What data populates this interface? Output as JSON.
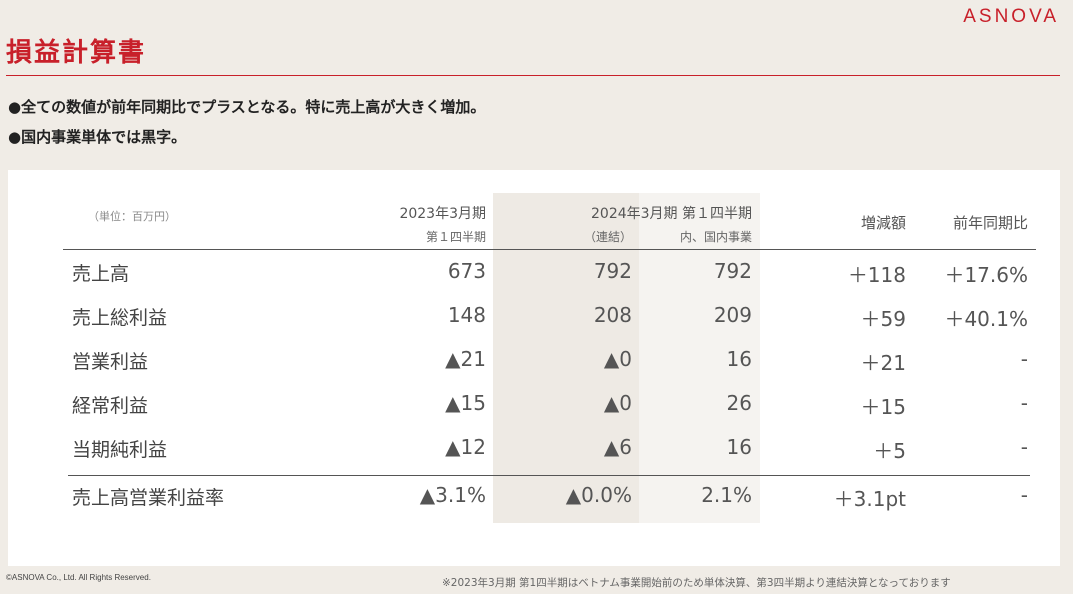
{
  "header": {
    "logo": "ASNOVA",
    "title": "損益計算書"
  },
  "bullets": [
    "●全ての数値が前年同期比でプラスとなる。特に売上高が大きく増加。",
    "●国内事業単体では黒字。"
  ],
  "table": {
    "unit": "（単位：百万円）",
    "col_prev": "2023年3月期",
    "col_prev_sub": "第１四半期",
    "col_curr": "2024年3月期 第１四半期",
    "col_curr_sub_a": "（連結）",
    "col_curr_sub_b": "内、国内事業",
    "col_diff": "増減額",
    "col_ratio": "前年同期比",
    "rows": [
      {
        "label": "売上高",
        "prev": "673",
        "cons": "792",
        "dom": "792",
        "diff": "＋118",
        "ratio": "＋17.6%"
      },
      {
        "label": "売上総利益",
        "prev": "148",
        "cons": "208",
        "dom": "209",
        "diff": "＋59",
        "ratio": "＋40.1%"
      },
      {
        "label": "営業利益",
        "prev": "▲21",
        "cons": "▲0",
        "dom": "16",
        "diff": "＋21",
        "ratio": "-"
      },
      {
        "label": "経常利益",
        "prev": "▲15",
        "cons": "▲0",
        "dom": "26",
        "diff": "＋15",
        "ratio": "-"
      },
      {
        "label": "当期純利益",
        "prev": "▲12",
        "cons": "▲6",
        "dom": "16",
        "diff": "＋5",
        "ratio": "-"
      }
    ],
    "margin_row": {
      "label": "売上高営業利益率",
      "prev": "▲3.1%",
      "cons": "▲0.0%",
      "dom": "2.1%",
      "diff": "＋3.1pt",
      "ratio": "-"
    }
  },
  "footer": {
    "copyright": "©ASNOVA Co., Ltd. All Rights Reserved.",
    "note": "※2023年3月期 第1四半期はベトナム事業開始前のため単体決算、第3四半期より連結決算となっております"
  }
}
